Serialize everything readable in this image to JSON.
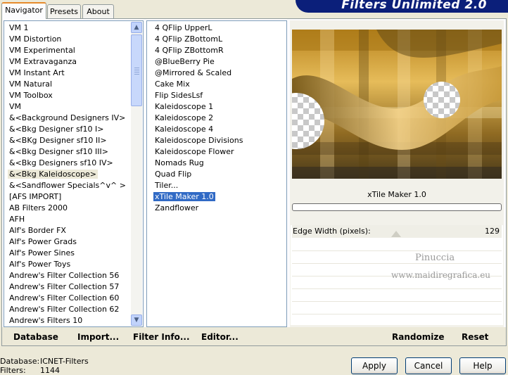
{
  "tabs": [
    "Navigator",
    "Presets",
    "About"
  ],
  "banner_title": "Filters Unlimited 2.0",
  "categories": [
    "VM 1",
    "VM Distortion",
    "VM Experimental",
    "VM Extravaganza",
    "VM Instant Art",
    "VM Natural",
    "VM Toolbox",
    "VM",
    "&<Background Designers IV>",
    "&<Bkg Designer sf10 I>",
    "&<BKg Designer sf10 II>",
    "&<Bkg Designer sf10 III>",
    "&<Bkg Designers sf10 IV>",
    "&<Bkg Kaleidoscope>",
    "&<Sandflower Specials^v^ >",
    "[AFS IMPORT]",
    "AB Filters 2000",
    "AFH",
    "Alf's Border FX",
    "Alf's Power Grads",
    "Alf's Power Sines",
    "Alf's Power Toys",
    "Andrew's Filter Collection 56",
    "Andrew's Filter Collection 57",
    "Andrew's Filter Collection 60",
    "Andrew's Filter Collection 62",
    "Andrew's Filters 10"
  ],
  "selected_category": "&<Bkg Kaleidoscope>",
  "filters": [
    "4 QFlip UpperL",
    "4 QFlip ZBottomL",
    "4 QFlip ZBottomR",
    "@BlueBerry Pie",
    "@Mirrored & Scaled",
    "Cake Mix",
    "Flip SidesLsf",
    "Kaleidoscope 1",
    "Kaleidoscope 2",
    "Kaleidoscope 4",
    "Kaleidoscope Divisions",
    "Kaleidoscope Flower",
    "Nomads Rug",
    "Quad Flip",
    "Tiler...",
    "xTile Maker 1.0",
    "Zandflower"
  ],
  "selected_filter": "xTile Maker 1.0",
  "preview_title": "xTile Maker 1.0",
  "param_label": "Edge Width (pixels):",
  "param_value": "129",
  "watermark_line1": "Pinuccia",
  "watermark_line2": "www.maidiregrafica.eu",
  "bottom_buttons": {
    "database": "Database",
    "import": "Import...",
    "filter_info": "Filter Info...",
    "editor": "Editor...",
    "randomize": "Randomize",
    "reset": "Reset"
  },
  "status": {
    "database_label": "Database:",
    "database_value": "ICNET-Filters",
    "filters_label": "Filters:",
    "filters_value": "1144"
  },
  "dialog_buttons": {
    "apply": "Apply",
    "cancel": "Cancel",
    "help": "Help"
  },
  "colors": {
    "selection": "#316ac5",
    "banner": "#0b1f7a",
    "tab_accent": "#e68b2c"
  }
}
